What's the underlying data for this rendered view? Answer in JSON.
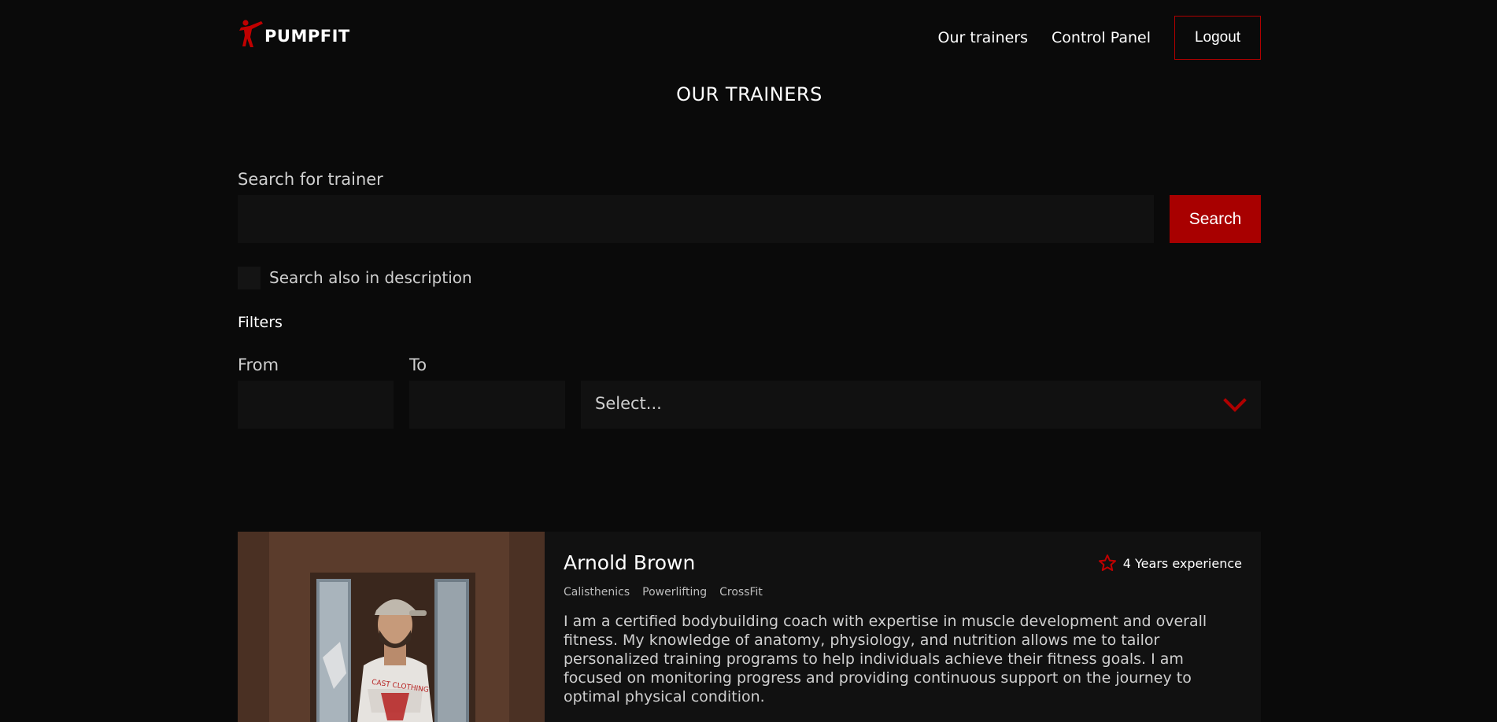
{
  "brand": {
    "name": "PUMPFIT",
    "accent_color": "#a80000"
  },
  "nav": {
    "items": [
      {
        "label": "Our trainers"
      },
      {
        "label": "Control Panel"
      }
    ],
    "logout_label": "Logout"
  },
  "page_title": "OUR TRAINERS",
  "search": {
    "label": "Search for trainer",
    "value": "",
    "button_label": "Search",
    "description_checkbox": {
      "label": "Search also in description",
      "checked": false
    }
  },
  "filters": {
    "title": "Filters",
    "from": {
      "label": "From",
      "value": ""
    },
    "to": {
      "label": "To",
      "value": ""
    },
    "select": {
      "value": "Select..."
    }
  },
  "trainers": [
    {
      "name": "Arnold Brown",
      "experience": "4 Years experience",
      "tags": [
        "Calisthenics",
        "Powerlifting",
        "CrossFit"
      ],
      "bio": "I am a certified bodybuilding coach with expertise in muscle development and overall fitness. My knowledge of anatomy, physiology, and nutrition allows me to tailor personalized training programs to help individuals achieve their fitness goals. I am focused on monitoring progress and providing continuous support on the journey to optimal physical condition.",
      "shirt_text": "CAST CLOTHING"
    }
  ]
}
